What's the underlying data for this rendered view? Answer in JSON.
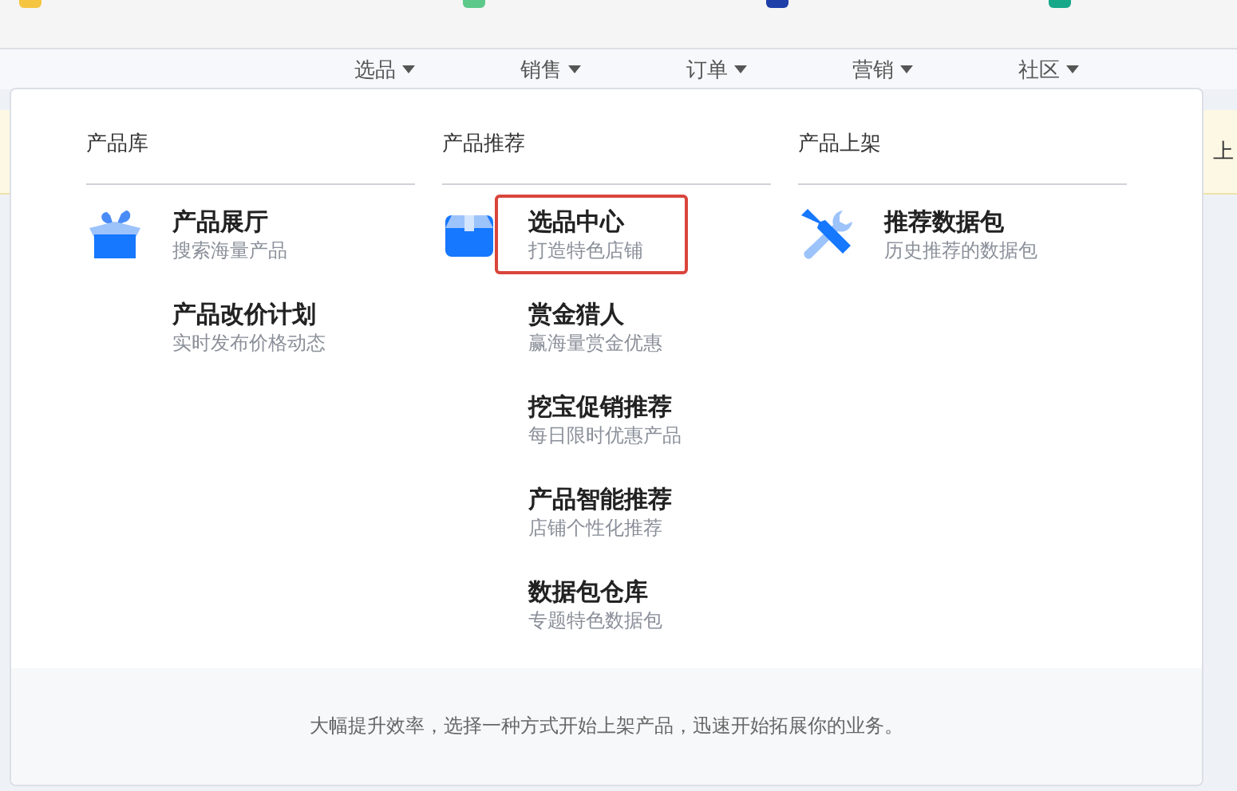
{
  "nav": [
    {
      "label": "选品"
    },
    {
      "label": "销售"
    },
    {
      "label": "订单"
    },
    {
      "label": "营销"
    },
    {
      "label": "社区"
    }
  ],
  "banner": {
    "text": "上"
  },
  "mega_menu": {
    "columns": [
      {
        "heading": "产品库",
        "items": [
          {
            "title": "产品展厅",
            "subtitle": "搜索海量产品",
            "icon": true,
            "selected": false
          },
          {
            "title": "产品改价计划",
            "subtitle": "实时发布价格动态",
            "icon": false,
            "selected": false
          }
        ]
      },
      {
        "heading": "产品推荐",
        "items": [
          {
            "title": "选品中心",
            "subtitle": "打造特色店铺",
            "icon": true,
            "selected": true
          },
          {
            "title": "赏金猎人",
            "subtitle": "赢海量赏金优惠",
            "icon": false,
            "selected": false
          },
          {
            "title": "挖宝促销推荐",
            "subtitle": "每日限时优惠产品",
            "icon": false,
            "selected": false
          },
          {
            "title": "产品智能推荐",
            "subtitle": "店铺个性化推荐",
            "icon": false,
            "selected": false
          },
          {
            "title": "数据包仓库",
            "subtitle": "专题特色数据包",
            "icon": false,
            "selected": false
          }
        ]
      },
      {
        "heading": "产品上架",
        "items": [
          {
            "title": "推荐数据包",
            "subtitle": "历史推荐的数据包",
            "icon": true,
            "selected": false
          }
        ]
      }
    ],
    "footer": "大幅提升效率，选择一种方式开始上架产品，迅速开始拓展你的业务。"
  }
}
